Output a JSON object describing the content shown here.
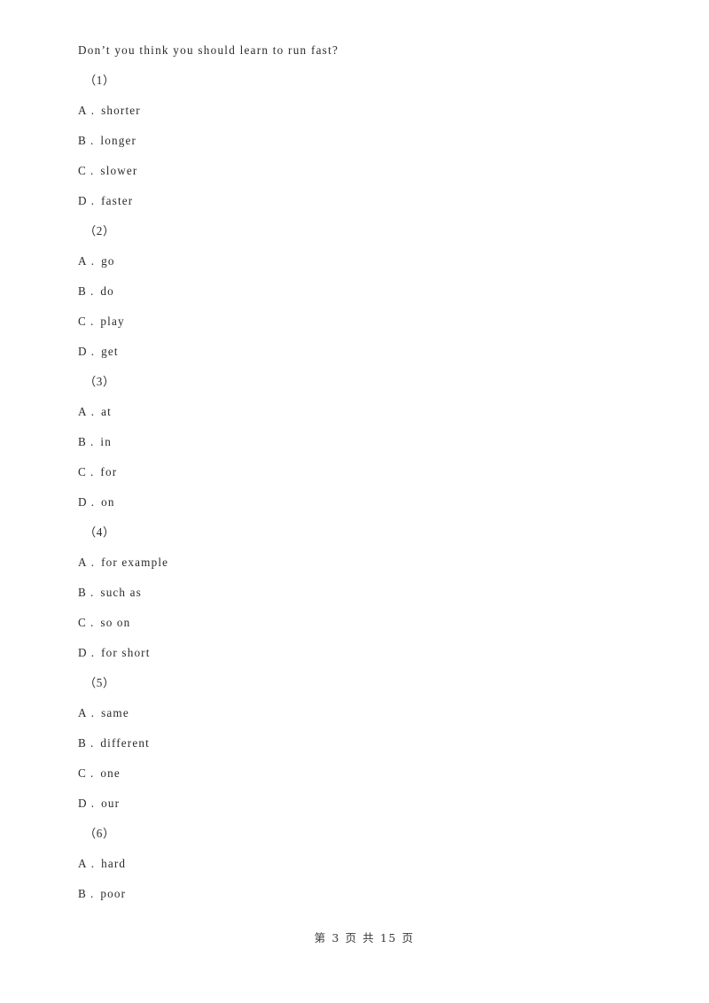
{
  "document": {
    "stem": "Don’t you think you should learn to run fast?",
    "questions": [
      {
        "number": "（1）",
        "options": [
          {
            "letter": "A",
            "sep": ".",
            "text": "shorter"
          },
          {
            "letter": "B",
            "sep": ".",
            "text": "longer"
          },
          {
            "letter": "C",
            "sep": ".",
            "text": "slower"
          },
          {
            "letter": "D",
            "sep": ".",
            "text": "faster"
          }
        ]
      },
      {
        "number": "（2）",
        "options": [
          {
            "letter": "A",
            "sep": ".",
            "text": "go"
          },
          {
            "letter": "B",
            "sep": ".",
            "text": "do"
          },
          {
            "letter": "C",
            "sep": ".",
            "text": "play"
          },
          {
            "letter": "D",
            "sep": ".",
            "text": "get"
          }
        ]
      },
      {
        "number": "（3）",
        "options": [
          {
            "letter": "A",
            "sep": ".",
            "text": "at"
          },
          {
            "letter": "B",
            "sep": ".",
            "text": "in"
          },
          {
            "letter": "C",
            "sep": ".",
            "text": "for"
          },
          {
            "letter": "D",
            "sep": ".",
            "text": "on"
          }
        ]
      },
      {
        "number": "（4）",
        "options": [
          {
            "letter": "A",
            "sep": ".",
            "text": "for example"
          },
          {
            "letter": "B",
            "sep": ".",
            "text": "such as"
          },
          {
            "letter": "C",
            "sep": ".",
            "text": "so on"
          },
          {
            "letter": "D",
            "sep": ".",
            "text": "for short"
          }
        ]
      },
      {
        "number": "（5）",
        "options": [
          {
            "letter": "A",
            "sep": ".",
            "text": "same"
          },
          {
            "letter": "B",
            "sep": ".",
            "text": "different"
          },
          {
            "letter": "C",
            "sep": ".",
            "text": "one"
          },
          {
            "letter": "D",
            "sep": ".",
            "text": "our"
          }
        ]
      },
      {
        "number": "（6）",
        "options": [
          {
            "letter": "A",
            "sep": ".",
            "text": "hard"
          },
          {
            "letter": "B",
            "sep": ".",
            "text": "poor"
          }
        ]
      }
    ]
  },
  "footer": {
    "prefix": "第",
    "current_page": "3",
    "middle": "页 共",
    "total_pages": "15",
    "suffix": "页",
    "full_text": "第 3 页 共 15 页"
  }
}
